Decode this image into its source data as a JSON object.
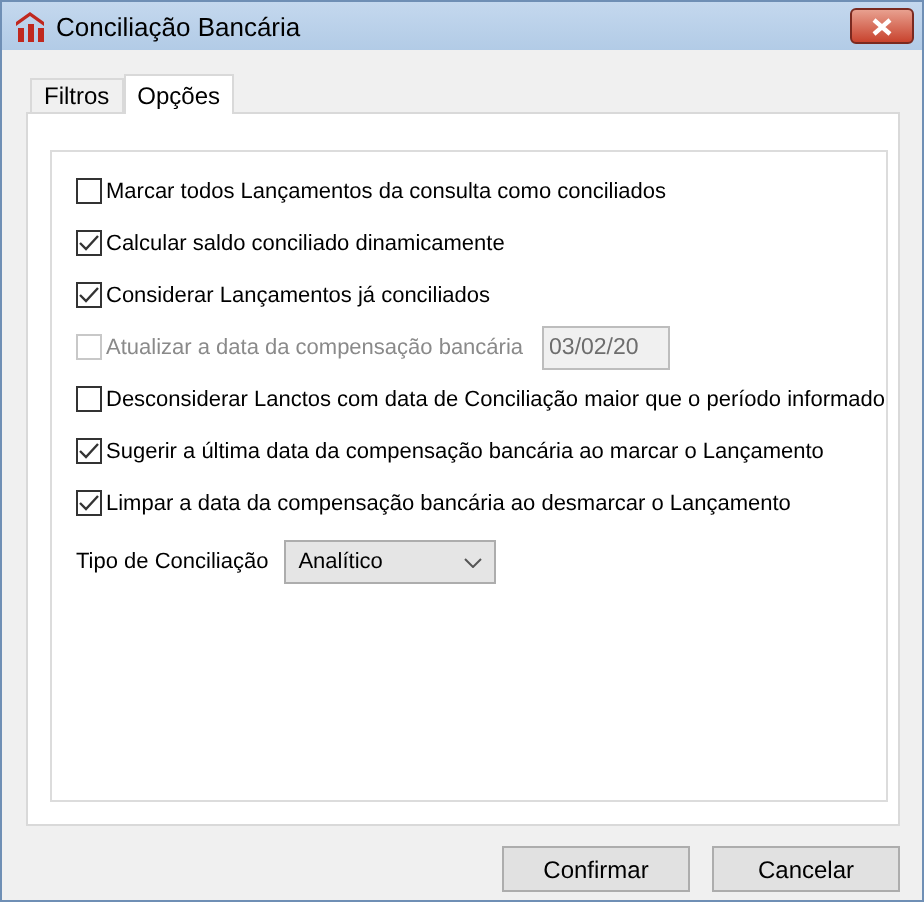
{
  "window": {
    "title": "Conciliação Bancária"
  },
  "tabs": [
    {
      "label": "Filtros",
      "selected": false
    },
    {
      "label": "Opções",
      "selected": true
    }
  ],
  "options": [
    {
      "label": "Marcar todos Lançamentos da consulta como conciliados",
      "checked": false,
      "disabled": false
    },
    {
      "label": "Calcular saldo conciliado dinamicamente",
      "checked": true,
      "disabled": false
    },
    {
      "label": "Considerar Lançamentos já conciliados",
      "checked": true,
      "disabled": false
    },
    {
      "label": "Atualizar a data da compensação bancária",
      "checked": false,
      "disabled": true,
      "date_value": "03/02/20"
    },
    {
      "label": "Desconsiderar Lanctos com data de Conciliação maior que o período informado",
      "checked": false,
      "disabled": false
    },
    {
      "label": "Sugerir a última data da compensação bancária ao marcar o Lançamento",
      "checked": true,
      "disabled": false
    },
    {
      "label": "Limpar a data da compensação bancária ao desmarcar o Lançamento",
      "checked": true,
      "disabled": false
    }
  ],
  "tipo_conciliacao": {
    "label": "Tipo de Conciliação",
    "value": "Analítico"
  },
  "buttons": [
    "Confirmar",
    "Cancelar"
  ]
}
